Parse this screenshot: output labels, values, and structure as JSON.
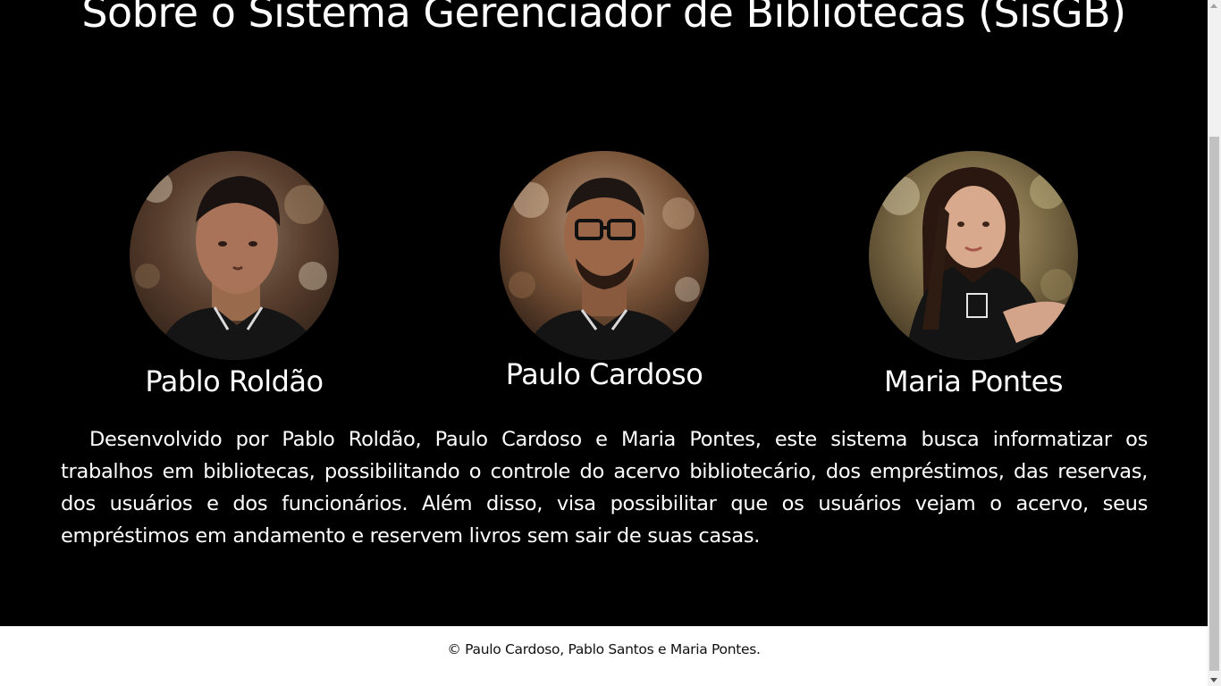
{
  "header": {
    "title": "Sobre o Sistema Gerenciador de Bibliotecas (SisGB)"
  },
  "team": [
    {
      "name": "Pablo Roldão",
      "photo": "pablo-photo"
    },
    {
      "name": "Paulo Cardoso",
      "photo": "paulo-photo"
    },
    {
      "name": "Maria Pontes",
      "photo": "maria-photo"
    }
  ],
  "about": {
    "text": "Desenvolvido por Pablo Roldão, Paulo Cardoso e Maria Pontes, este sistema busca informatizar os trabalhos em bibliotecas, possibilitando o controle do acervo bibliotecário, dos empréstimos, das reservas, dos usuários e dos funcionários. Além disso, visa possibilitar que os usuários vejam o acervo, seus empréstimos em andamento e reservem livros sem sair de suas casas."
  },
  "footer": {
    "copyright": "© Paulo Cardoso, Pablo Santos e Maria Pontes."
  },
  "colors": {
    "background": "#000000",
    "text": "#ffffff",
    "footer_background": "#ffffff",
    "footer_text": "#111111"
  }
}
